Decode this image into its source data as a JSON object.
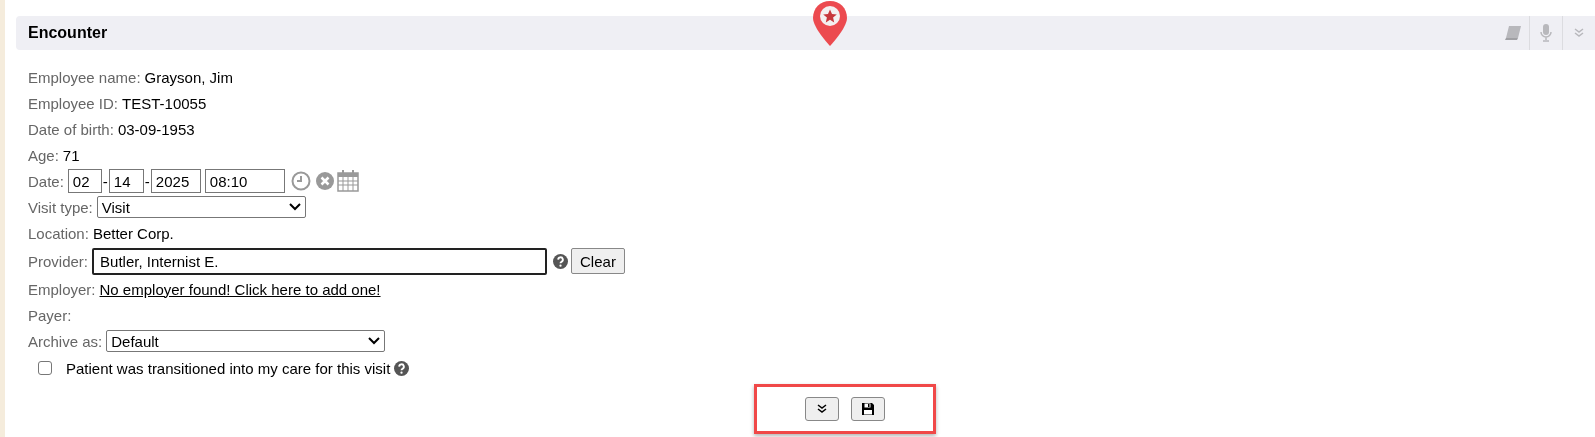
{
  "panel": {
    "title": "Encounter"
  },
  "fields": [
    {
      "kind": "text",
      "label": "Employee name:",
      "value": "Grayson, Jim"
    },
    {
      "kind": "text",
      "label": "Employee ID:",
      "value": "TEST-10055"
    },
    {
      "kind": "text",
      "label": "Date of birth:",
      "value": "03-09-1953"
    },
    {
      "kind": "text",
      "label": "Age:",
      "value": "71"
    },
    {
      "kind": "date",
      "label": "Date:",
      "month": "02",
      "day": "14",
      "year": "2025",
      "time": "08:10",
      "separator": "-"
    },
    {
      "kind": "select",
      "label": "Visit type:",
      "value": "Visit"
    },
    {
      "kind": "text",
      "label": "Location:",
      "value": "Better Corp."
    },
    {
      "kind": "input",
      "label": "Provider:",
      "value": "Butler, Internist E.",
      "button": "Clear"
    },
    {
      "kind": "link",
      "label": "Employer:",
      "value": "No employer found! Click here to add one!"
    },
    {
      "kind": "empty",
      "label": "Payer:"
    },
    {
      "kind": "select",
      "label": "Archive as:",
      "value": "Default"
    }
  ],
  "checkbox": {
    "label": "Patient was transitioned into my care for this visit",
    "checked": false
  },
  "toolbar": {
    "highlighted": true
  }
}
